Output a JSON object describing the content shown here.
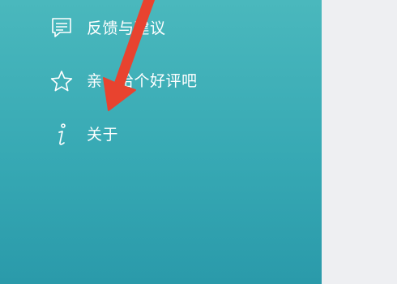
{
  "menu": {
    "items": [
      {
        "label": "反馈与建议",
        "icon": "chat-bubble-icon"
      },
      {
        "label": "亲，给个好评吧",
        "icon": "star-icon"
      },
      {
        "label": "关于",
        "icon": "info-icon"
      }
    ]
  },
  "colors": {
    "drawer_top": "#4ab8bd",
    "drawer_bottom": "#2a9aaa",
    "right_pane": "#eeeff2",
    "annotation_arrow": "#e8432f",
    "text": "#ffffff"
  }
}
